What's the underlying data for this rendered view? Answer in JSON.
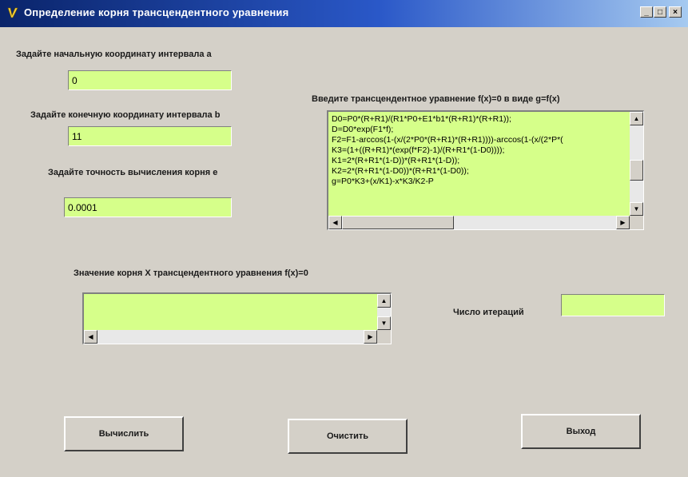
{
  "window": {
    "title": "Определение корня трансцендентного уравнения",
    "minimize_glyph": "_",
    "maximize_glyph": "□",
    "close_glyph": "×"
  },
  "inputs": {
    "a": {
      "label": "Задайте начальную координату интервала   a",
      "value": "0"
    },
    "b": {
      "label": "Задайте конечную координату интервала   b",
      "value": "11"
    },
    "e": {
      "label": "Задайте точность вычисления корня   e",
      "value": "0.0001"
    }
  },
  "equation": {
    "label": "Введите трансцендентное уравнение  f(x)=0 в виде  g=f(x)",
    "lines": [
      "D0=P0*(R+R1)/(R1*P0+E1*b1*(R+R1)*(R+R1));",
      "D=D0*exp(F1*f);",
      "F2=F1-arccos(1-(x/(2*P0*(R+R1)*(R+R1))))-arccos(1-(x/(2*P*(",
      "K3=(1+((R+R1)*(exp(f*F2)-1)/(R+R1*(1-D0))));",
      "K1=2*(R+R1*(1-D))*(R+R1*(1-D));",
      "K2=2*(R+R1*(1-D0))*(R+R1*(1-D0));",
      "g=P0*K3+(x/K1)-x*K3/K2-P"
    ]
  },
  "result": {
    "label": "Значение корня  X  трансцендентного уравнения  f(x)=0",
    "value": ""
  },
  "iterations": {
    "label": "Число итераций",
    "value": ""
  },
  "buttons": {
    "calculate": "Вычислить",
    "clear": "Очистить",
    "exit": "Выход"
  },
  "scroll_glyphs": {
    "up": "▲",
    "down": "▼",
    "left": "◀",
    "right": "▶"
  },
  "colors": {
    "field_bg": "#d6ff8a",
    "window_bg": "#d4d0c8",
    "titlebar_start": "#0a246a",
    "titlebar_end": "#a6caf0"
  }
}
